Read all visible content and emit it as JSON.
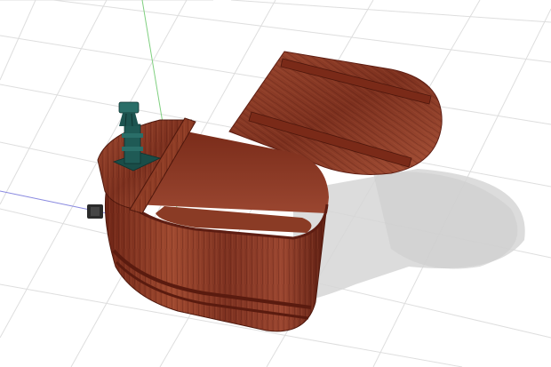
{
  "scene": {
    "type": "3d-model-viewport",
    "subject": "wooden-bath-tub-with-stove",
    "colors": {
      "background": "#ffffff",
      "grid": "#dcdcdc",
      "axis_y": "#7fd07f",
      "axis_x": "#8a8ae0",
      "wood_dark": "#5e1d12",
      "wood_mid": "#8a3a24",
      "wood_light": "#a5533a",
      "stove": "#1f5a55",
      "stove_dark": "#123a37",
      "shadow": "#d2d2d2"
    },
    "parts": [
      "floor-grid",
      "axis-lines",
      "shadow",
      "tub-body",
      "open-lid",
      "inner-lid",
      "stove-chimney",
      "handle"
    ]
  }
}
